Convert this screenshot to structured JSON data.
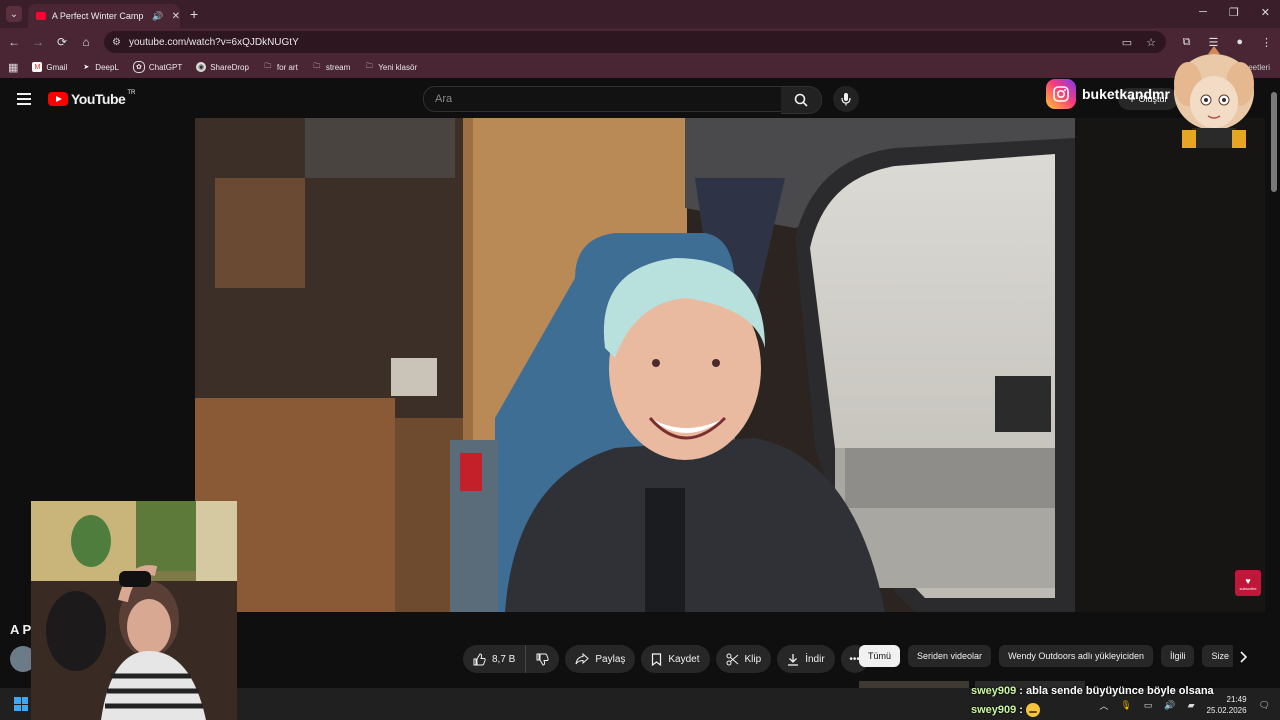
{
  "browser": {
    "tab_title": "A Perfect Winter Camp - Yo",
    "tab_close": "✕",
    "new_tab": "+",
    "url": "youtube.com/watch?v=6xQJDkNUGtY",
    "bookmarks": [
      "Gmail",
      "DeepL",
      "ChatGPT",
      "ShareDrop",
      "for art",
      "stream",
      "Yeni klasör"
    ],
    "bookmarks_right": "eetleri"
  },
  "youtube": {
    "logo_text": "YouTube",
    "country_code": "TR",
    "search_placeholder": "Ara",
    "create_label": "Oluştur",
    "title_fragment": "A P",
    "like_count": "8,7 B",
    "share_label": "Paylaş",
    "save_label": "Kaydet",
    "clip_label": "Klip",
    "download_label": "İndir",
    "chips": [
      "Tümü",
      "Seriden videolar",
      "Wendy Outdoors adlı yükleyiciden",
      "İlgili",
      "Size"
    ],
    "subscribe_badge": "subscribe"
  },
  "overlay": {
    "instagram_handle": "buketkandmr"
  },
  "chat": [
    {
      "user": "swey909",
      "message": ": abla sende büyüyünce böyle olsana"
    },
    {
      "user": "swey909",
      "message": ":"
    }
  ],
  "taskbar": {
    "time": "21:49",
    "date": "25.02.2026"
  },
  "colors": {
    "browser_tab_bg": "#3a1f2a",
    "browser_bar_bg": "#4a2634",
    "youtube_red": "#ff0000",
    "page_bg": "#0f0f0f"
  }
}
